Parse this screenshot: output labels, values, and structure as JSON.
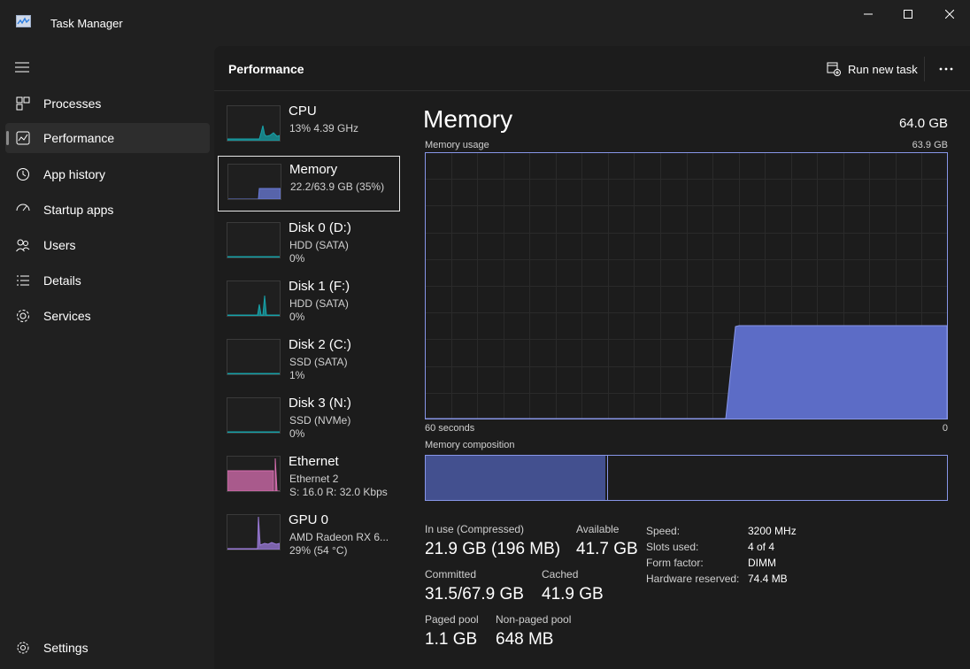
{
  "window": {
    "title": "Task Manager"
  },
  "sidebar": {
    "items": [
      {
        "label": "Processes",
        "icon": "processes-icon"
      },
      {
        "label": "Performance",
        "icon": "performance-icon",
        "active": true
      },
      {
        "label": "App history",
        "icon": "history-icon"
      },
      {
        "label": "Startup apps",
        "icon": "startup-icon"
      },
      {
        "label": "Users",
        "icon": "users-icon"
      },
      {
        "label": "Details",
        "icon": "details-icon"
      },
      {
        "label": "Services",
        "icon": "services-icon"
      }
    ],
    "settings_label": "Settings"
  },
  "header": {
    "title": "Performance",
    "run_task_label": "Run new task"
  },
  "devices": [
    {
      "name": "CPU",
      "sub1": "13%  4.39 GHz",
      "sub2": "",
      "color": "#17a1a8"
    },
    {
      "name": "Memory",
      "sub1": "22.2/63.9 GB (35%)",
      "sub2": "",
      "color": "#6b7cd9",
      "selected": true
    },
    {
      "name": "Disk 0 (D:)",
      "sub1": "HDD (SATA)",
      "sub2": "0%",
      "color": "#17a1a8"
    },
    {
      "name": "Disk 1 (F:)",
      "sub1": "HDD (SATA)",
      "sub2": "0%",
      "color": "#17a1a8"
    },
    {
      "name": "Disk 2 (C:)",
      "sub1": "SSD (SATA)",
      "sub2": "1%",
      "color": "#17a1a8"
    },
    {
      "name": "Disk 3 (N:)",
      "sub1": "SSD (NVMe)",
      "sub2": "0%",
      "color": "#17a1a8"
    },
    {
      "name": "Ethernet",
      "sub1": "Ethernet 2",
      "sub2": "S: 16.0  R: 32.0 Kbps",
      "color": "#d86fb1"
    },
    {
      "name": "GPU 0",
      "sub1": "AMD Radeon RX 6...",
      "sub2": "29%  (54 °C)",
      "color": "#9b7bd9"
    }
  ],
  "memory": {
    "title": "Memory",
    "total": "64.0 GB",
    "usage_label": "Memory usage",
    "usage_max": "63.9 GB",
    "time_left": "60 seconds",
    "time_right": "0",
    "composition_label": "Memory composition",
    "composition_in_use_fraction": 0.345,
    "graph_usage_fraction": 0.35,
    "stats": {
      "in_use_label": "In use (Compressed)",
      "in_use_value": "21.9 GB (196 MB)",
      "available_label": "Available",
      "available_value": "41.7 GB",
      "committed_label": "Committed",
      "committed_value": "31.5/67.9 GB",
      "cached_label": "Cached",
      "cached_value": "41.9 GB",
      "paged_label": "Paged pool",
      "paged_value": "1.1 GB",
      "nonpaged_label": "Non-paged pool",
      "nonpaged_value": "648 MB"
    },
    "specs": [
      {
        "label": "Speed:",
        "value": "3200 MHz"
      },
      {
        "label": "Slots used:",
        "value": "4 of 4"
      },
      {
        "label": "Form factor:",
        "value": "DIMM"
      },
      {
        "label": "Hardware reserved:",
        "value": "74.4 MB"
      }
    ]
  },
  "colors": {
    "accent": "#6b7cd9",
    "graph_border": "#8796e8"
  }
}
